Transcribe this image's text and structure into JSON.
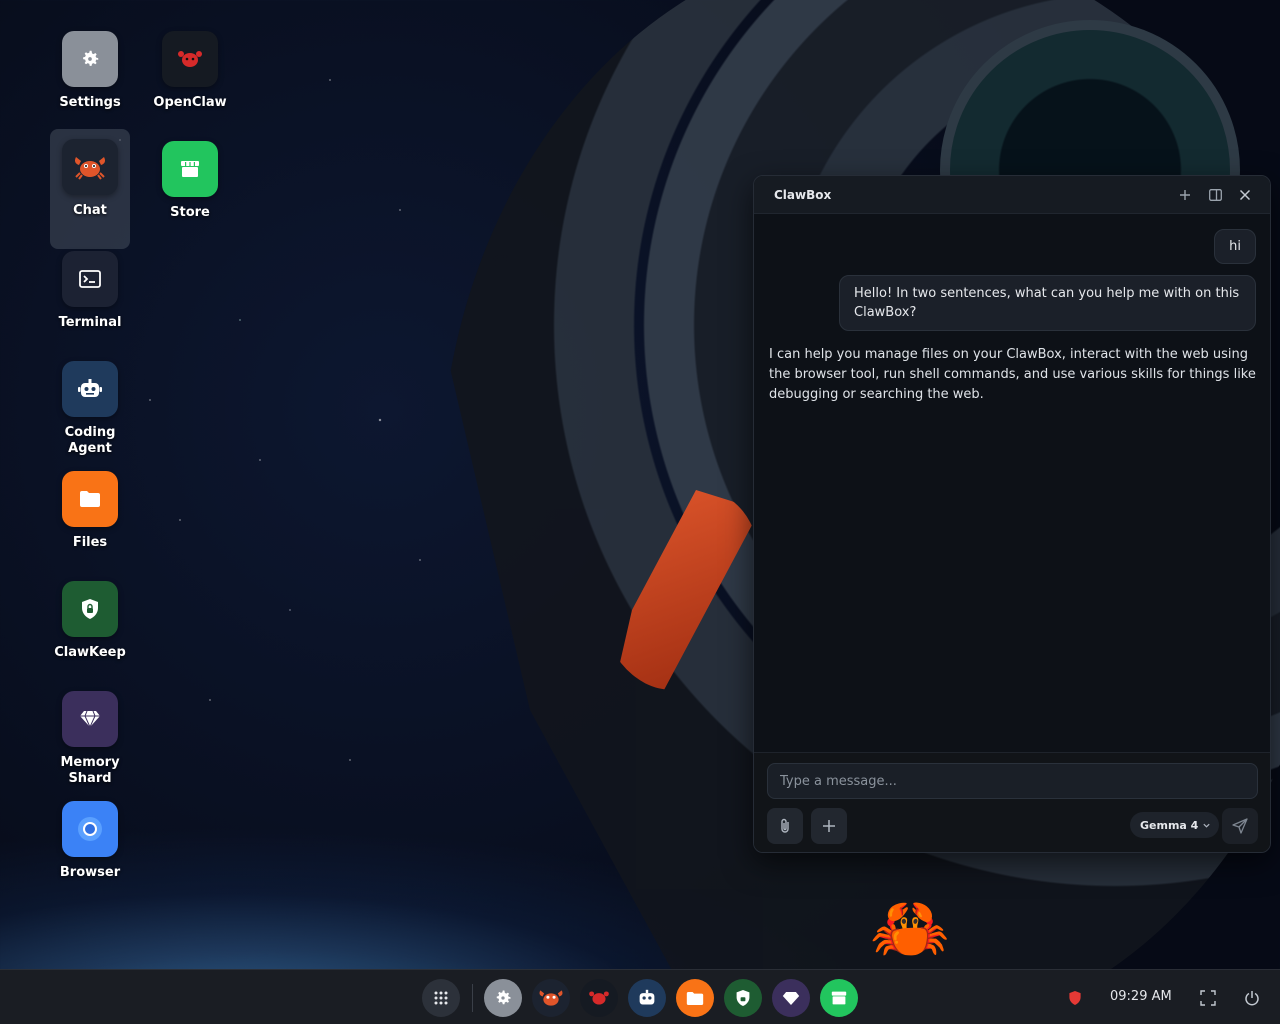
{
  "desktop": {
    "icons": [
      {
        "label": "Settings"
      },
      {
        "label": "OpenClaw"
      },
      {
        "label": "Chat"
      },
      {
        "label": "Store"
      },
      {
        "label": "Terminal"
      },
      {
        "label": "Coding Agent"
      },
      {
        "label": "Files"
      },
      {
        "label": "ClawKeep"
      },
      {
        "label": "Memory Shard"
      },
      {
        "label": "Browser"
      }
    ]
  },
  "window": {
    "title": "ClawBox",
    "messages": [
      {
        "role": "user",
        "text": "hi"
      },
      {
        "role": "user",
        "text": "Hello! In two sentences, what can you help me with on this ClawBox?"
      },
      {
        "role": "assistant",
        "text": "I can help you manage files on your ClawBox, interact with the web using the browser tool, run shell commands, and use various skills for things like debugging or searching the web."
      }
    ],
    "composer": {
      "placeholder": "Type a message...",
      "model": "Gemma 4"
    }
  },
  "taskbar": {
    "clock": "09:29 AM"
  },
  "colors": {
    "settings": "#8a9099",
    "openclaw": "#151a22",
    "chat": "#1c2330",
    "store": "#22c55e",
    "terminal": "#1c2233",
    "coding": "#1f3a5c",
    "files": "#f97316",
    "clawkeep": "#1e5c32",
    "memory": "#3b2f5c",
    "browser": "#3b82f6",
    "shield_red": "#e53935"
  }
}
